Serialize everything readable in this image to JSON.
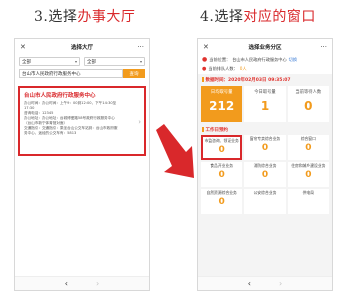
{
  "steps": [
    {
      "prefix": "3.选择",
      "highlight": "办事大厅"
    },
    {
      "prefix": "4.选择",
      "highlight": "对应的窗口"
    }
  ],
  "hall_screen": {
    "title": "选择大厅",
    "close_icon": "close-icon",
    "more_icon": "more-icon",
    "filter1": "全部",
    "filter2": "全部",
    "search_value": "台山市人民政府行政服务中心",
    "search_button": "查询",
    "center": {
      "name": "台山市人民政府行政服务中心",
      "lines": [
        "办公时间：办公时间：上午9：00到12:00，下午14:30至",
        "17:30",
        "咨询电话：12345",
        "办公地址：办公地址：台城博爱路58号政府行政服务中心",
        "（台山市新宁体育馆对面）",
        "交通指引：交通指引：乘坐台山公交车站到：台山市政府服",
        "务中心，途经的公交车有：5813"
      ]
    },
    "bottom_back": "‹",
    "bottom_forward": "›"
  },
  "window_screen": {
    "title": "选择业务分区",
    "location_label": "当前位置：",
    "location_value": "台山市人民政府行政服务中心",
    "switch_label": "切换",
    "queue_label": "当前排队人数：",
    "queue_value": "0人",
    "update_text": "数据时间：2020年02月03日 09:35:07",
    "stats": [
      {
        "label": "日均取号量",
        "value": "212"
      },
      {
        "label": "今日取号量",
        "value": "1"
      },
      {
        "label": "当前等待人数",
        "value": "0"
      }
    ],
    "section_title": "工作日预约",
    "windows": [
      {
        "label": "市监咨询、领证业务",
        "value": "0"
      },
      {
        "label": "窗帘专卖综合业务",
        "value": "0"
      },
      {
        "label": "综合窗口",
        "value": "0"
      },
      {
        "label": "食品开业业务",
        "value": "0"
      },
      {
        "label": "消防综合业务",
        "value": "0"
      },
      {
        "label": "住房和城乡建设业务",
        "value": "0"
      },
      {
        "label": "自然资源综合业务",
        "value": "0"
      },
      {
        "label": "公安综合业务",
        "value": ""
      },
      {
        "label": "供电局",
        "value": ""
      }
    ],
    "bottom_back": "‹",
    "bottom_forward": "›"
  },
  "colors": {
    "accent": "#d9282b",
    "orange": "#f29b1d"
  }
}
